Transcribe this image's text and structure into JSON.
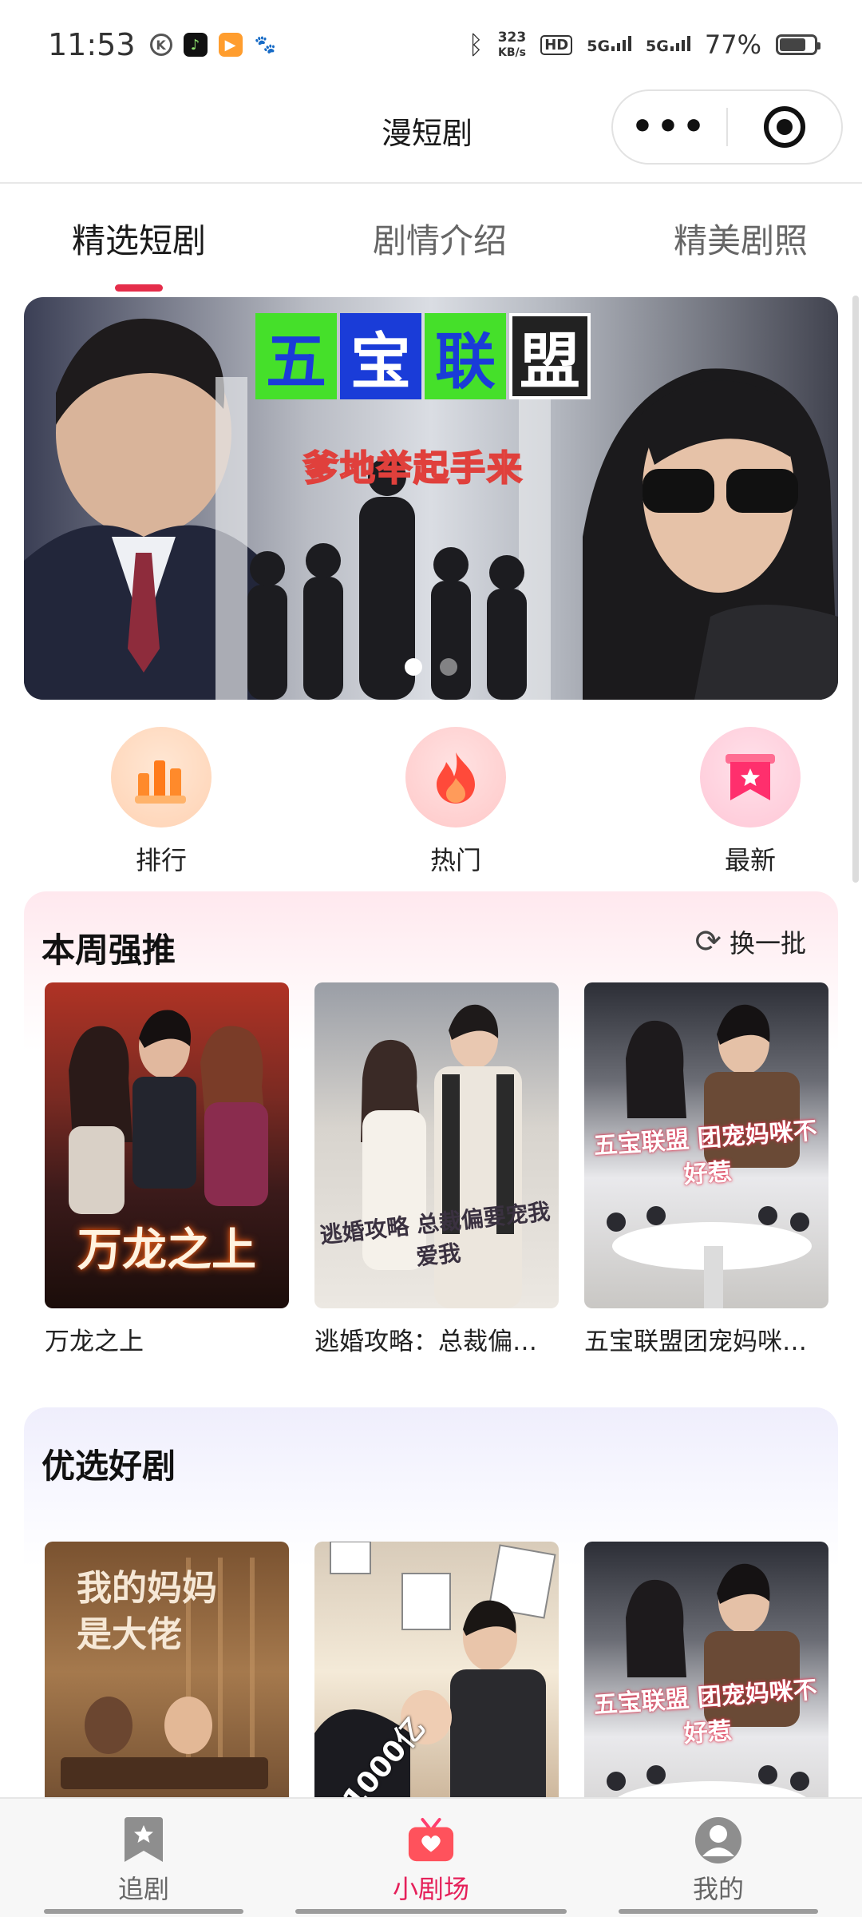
{
  "status_bar": {
    "time": "11:53",
    "net_speed_value": "323",
    "net_speed_unit": "KB/s",
    "hd_label": "HD",
    "signal1": "5G",
    "signal2": "5G",
    "battery_percent_text": "77%",
    "battery_level": 0.77
  },
  "header": {
    "title": "漫短剧",
    "more_glyph": "•••"
  },
  "tabs": [
    {
      "label": "精选短剧",
      "active": true
    },
    {
      "label": "剧情介绍",
      "active": false
    },
    {
      "label": "精美剧照",
      "active": false
    }
  ],
  "banner": {
    "title_chars": [
      "五",
      "宝",
      "联",
      "盟"
    ],
    "subtitle": "爹地举起手来",
    "slide_count": 2,
    "active_slide": 1
  },
  "quick_links": [
    {
      "label": "排行",
      "icon": "bar-chart-icon"
    },
    {
      "label": "热门",
      "icon": "flame-icon"
    },
    {
      "label": "最新",
      "icon": "ribbon-star-icon"
    }
  ],
  "weekly_section": {
    "title": "本周强推",
    "refresh_label": "换一批",
    "items": [
      {
        "name": "万龙之上",
        "poster_text": "万龙之上"
      },
      {
        "name": "逃婚攻略：总裁偏…",
        "poster_text": "逃婚攻略 总裁偏要宠我爱我"
      },
      {
        "name": "五宝联盟团宠妈咪…",
        "poster_text": "五宝联盟 团宠妈咪不好惹"
      }
    ]
  },
  "picks_section": {
    "title": "优选好剧",
    "items": [
      {
        "poster_text": "我的妈妈是大佬"
      },
      {
        "poster_text": "1000亿"
      },
      {
        "poster_text": "五宝联盟 团宠妈咪不好惹"
      }
    ]
  },
  "bottom_nav": [
    {
      "label": "追剧",
      "icon": "bookmark-star-icon",
      "active": false
    },
    {
      "label": "小剧场",
      "icon": "tv-heart-icon",
      "active": true
    },
    {
      "label": "我的",
      "icon": "user-icon",
      "active": false
    }
  ],
  "colors": {
    "accent": "#e52d4a",
    "nav_active": "#e5205a"
  }
}
